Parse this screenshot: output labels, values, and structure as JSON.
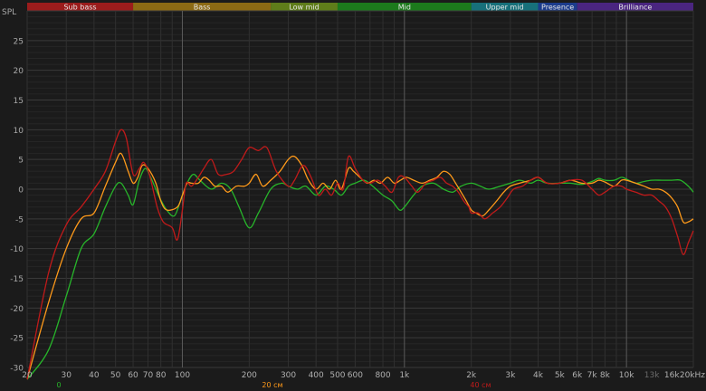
{
  "chart_data": {
    "type": "line",
    "ylabel": "SPL",
    "x_scale": "log",
    "xlim": [
      20,
      20000
    ],
    "ylim": [
      -30,
      30
    ],
    "grid": true,
    "y_ticks": [
      25,
      20,
      15,
      10,
      5,
      0,
      -5,
      -10,
      -15,
      -20,
      -25,
      -30
    ],
    "x_ticks": [
      {
        "value": 20,
        "label": "20"
      },
      {
        "value": 30,
        "label": "30"
      },
      {
        "value": 40,
        "label": "40"
      },
      {
        "value": 50,
        "label": "50"
      },
      {
        "value": 60,
        "label": "60"
      },
      {
        "value": 70,
        "label": "70"
      },
      {
        "value": 80,
        "label": "80"
      },
      {
        "value": 100,
        "label": "100"
      },
      {
        "value": 200,
        "label": "200"
      },
      {
        "value": 300,
        "label": "300"
      },
      {
        "value": 400,
        "label": "400"
      },
      {
        "value": 500,
        "label": "500"
      },
      {
        "value": 600,
        "label": "600"
      },
      {
        "value": 800,
        "label": "800"
      },
      {
        "value": 1000,
        "label": "1k"
      },
      {
        "value": 2000,
        "label": "2k"
      },
      {
        "value": 3000,
        "label": "3k"
      },
      {
        "value": 4000,
        "label": "4k"
      },
      {
        "value": 5000,
        "label": "5k"
      },
      {
        "value": 6000,
        "label": "6k"
      },
      {
        "value": 7000,
        "label": "7k"
      },
      {
        "value": 8000,
        "label": "8k"
      },
      {
        "value": 10000,
        "label": "10k"
      },
      {
        "value": 13000,
        "label": "13k"
      },
      {
        "value": 16000,
        "label": "16k"
      },
      {
        "value": 20000,
        "label": "20kHz"
      }
    ],
    "bands": [
      {
        "name": "Sub bass",
        "from": 20,
        "to": 60,
        "color": "#9b1c1c"
      },
      {
        "name": "Bass",
        "from": 60,
        "to": 250,
        "color": "#8c6a14"
      },
      {
        "name": "Low mid",
        "from": 250,
        "to": 500,
        "color": "#5f7d1a"
      },
      {
        "name": "Mid",
        "from": 500,
        "to": 2000,
        "color": "#1c7a1c"
      },
      {
        "name": "Upper mid",
        "from": 2000,
        "to": 4000,
        "color": "#17707a"
      },
      {
        "name": "Presence",
        "from": 4000,
        "to": 6000,
        "color": "#1c3c8c"
      },
      {
        "name": "Brilliance",
        "from": 6000,
        "to": 20000,
        "color": "#4a2580"
      }
    ],
    "series": [
      {
        "name": "0",
        "color": "#27b52a",
        "points": [
          [
            20,
            -32
          ],
          [
            25,
            -27
          ],
          [
            30,
            -18
          ],
          [
            35,
            -10
          ],
          [
            40,
            -7.5
          ],
          [
            45,
            -3
          ],
          [
            50,
            0.5
          ],
          [
            53,
            1
          ],
          [
            57,
            -1
          ],
          [
            60,
            -2.6
          ],
          [
            64,
            1.5
          ],
          [
            68,
            3.5
          ],
          [
            72,
            2
          ],
          [
            78,
            -1
          ],
          [
            85,
            -3.5
          ],
          [
            92,
            -4.5
          ],
          [
            98,
            -2
          ],
          [
            105,
            1
          ],
          [
            112,
            2.5
          ],
          [
            120,
            1.5
          ],
          [
            135,
            0
          ],
          [
            150,
            1
          ],
          [
            165,
            0
          ],
          [
            180,
            -3
          ],
          [
            200,
            -6.5
          ],
          [
            220,
            -4
          ],
          [
            250,
            0
          ],
          [
            280,
            1
          ],
          [
            300,
            0.5
          ],
          [
            330,
            0
          ],
          [
            360,
            0.5
          ],
          [
            400,
            -1
          ],
          [
            440,
            0.5
          ],
          [
            480,
            0
          ],
          [
            520,
            -1
          ],
          [
            560,
            0.5
          ],
          [
            600,
            1
          ],
          [
            660,
            1.5
          ],
          [
            720,
            0.5
          ],
          [
            800,
            -1
          ],
          [
            880,
            -2
          ],
          [
            950,
            -3.5
          ],
          [
            1000,
            -3
          ],
          [
            1100,
            -1
          ],
          [
            1200,
            0.5
          ],
          [
            1350,
            1
          ],
          [
            1500,
            0
          ],
          [
            1650,
            -0.5
          ],
          [
            1800,
            0.5
          ],
          [
            2000,
            1
          ],
          [
            2200,
            0.5
          ],
          [
            2400,
            0
          ],
          [
            2700,
            0.5
          ],
          [
            3000,
            1
          ],
          [
            3300,
            1.5
          ],
          [
            3700,
            1
          ],
          [
            4000,
            1.5
          ],
          [
            4400,
            1
          ],
          [
            5000,
            1
          ],
          [
            5600,
            1
          ],
          [
            6300,
            0.8
          ],
          [
            7000,
            1.3
          ],
          [
            7500,
            1.8
          ],
          [
            8000,
            1.5
          ],
          [
            8800,
            1.5
          ],
          [
            9500,
            2
          ],
          [
            10000,
            1.7
          ],
          [
            11000,
            1
          ],
          [
            12000,
            1.3
          ],
          [
            13000,
            1.5
          ],
          [
            14500,
            1.5
          ],
          [
            16000,
            1.5
          ],
          [
            17500,
            1.5
          ],
          [
            19000,
            0.5
          ],
          [
            20000,
            -0.5
          ]
        ]
      },
      {
        "name": "20 см",
        "color": "#ff9a1a",
        "points": [
          [
            20,
            -32
          ],
          [
            25,
            -19
          ],
          [
            30,
            -10
          ],
          [
            35,
            -5
          ],
          [
            40,
            -4
          ],
          [
            45,
            0.5
          ],
          [
            50,
            4.5
          ],
          [
            53,
            6
          ],
          [
            57,
            3
          ],
          [
            60,
            1
          ],
          [
            63,
            2
          ],
          [
            66,
            4
          ],
          [
            70,
            3.5
          ],
          [
            76,
            1
          ],
          [
            80,
            -2
          ],
          [
            85,
            -3.5
          ],
          [
            95,
            -3
          ],
          [
            100,
            -1
          ],
          [
            105,
            1
          ],
          [
            110,
            1
          ],
          [
            118,
            1
          ],
          [
            125,
            2
          ],
          [
            132,
            1.5
          ],
          [
            140,
            0.5
          ],
          [
            150,
            0.5
          ],
          [
            160,
            -0.5
          ],
          [
            175,
            0.5
          ],
          [
            190,
            0.5
          ],
          [
            200,
            1
          ],
          [
            215,
            2.5
          ],
          [
            230,
            0.5
          ],
          [
            250,
            1.5
          ],
          [
            275,
            3
          ],
          [
            300,
            5
          ],
          [
            320,
            5.5
          ],
          [
            345,
            4
          ],
          [
            370,
            1.5
          ],
          [
            400,
            0
          ],
          [
            430,
            1
          ],
          [
            460,
            0
          ],
          [
            490,
            1.5
          ],
          [
            520,
            0
          ],
          [
            560,
            3.5
          ],
          [
            590,
            3
          ],
          [
            630,
            2
          ],
          [
            680,
            1
          ],
          [
            730,
            1.5
          ],
          [
            780,
            1
          ],
          [
            840,
            2
          ],
          [
            900,
            1
          ],
          [
            960,
            1.5
          ],
          [
            1020,
            2
          ],
          [
            1100,
            1.5
          ],
          [
            1200,
            1
          ],
          [
            1300,
            1.5
          ],
          [
            1400,
            2
          ],
          [
            1500,
            3
          ],
          [
            1600,
            2.5
          ],
          [
            1700,
            1
          ],
          [
            1800,
            -0.5
          ],
          [
            1900,
            -2
          ],
          [
            2000,
            -3.5
          ],
          [
            2100,
            -4
          ],
          [
            2250,
            -4.5
          ],
          [
            2400,
            -3.5
          ],
          [
            2600,
            -2
          ],
          [
            2800,
            -0.5
          ],
          [
            3000,
            0.5
          ],
          [
            3300,
            1
          ],
          [
            3700,
            1.5
          ],
          [
            4000,
            2
          ],
          [
            4400,
            1
          ],
          [
            5000,
            1
          ],
          [
            5600,
            1.5
          ],
          [
            6300,
            1
          ],
          [
            7000,
            1
          ],
          [
            7500,
            1.5
          ],
          [
            8000,
            1.2
          ],
          [
            8800,
            0.5
          ],
          [
            9500,
            1.5
          ],
          [
            10000,
            1.5
          ],
          [
            11000,
            1
          ],
          [
            12000,
            0.5
          ],
          [
            13000,
            0
          ],
          [
            14000,
            0
          ],
          [
            15000,
            -0.5
          ],
          [
            16000,
            -1.5
          ],
          [
            17000,
            -3
          ],
          [
            18000,
            -5.5
          ],
          [
            19000,
            -5.5
          ],
          [
            20000,
            -5
          ]
        ]
      },
      {
        "name": "40 см",
        "color": "#c01a1a",
        "points": [
          [
            20,
            -32
          ],
          [
            25,
            -14
          ],
          [
            30,
            -6
          ],
          [
            35,
            -3
          ],
          [
            40,
            0
          ],
          [
            45,
            3
          ],
          [
            50,
            8
          ],
          [
            53,
            10
          ],
          [
            56,
            8.5
          ],
          [
            60,
            2.5
          ],
          [
            64,
            3.5
          ],
          [
            67,
            4.5
          ],
          [
            71,
            2.5
          ],
          [
            77,
            -3
          ],
          [
            82,
            -5.5
          ],
          [
            90,
            -6.5
          ],
          [
            95,
            -8.5
          ],
          [
            100,
            -3.5
          ],
          [
            104,
            1
          ],
          [
            110,
            0.5
          ],
          [
            118,
            2
          ],
          [
            125,
            3.5
          ],
          [
            135,
            5
          ],
          [
            145,
            2.5
          ],
          [
            158,
            2.5
          ],
          [
            170,
            3
          ],
          [
            185,
            5
          ],
          [
            200,
            7
          ],
          [
            220,
            6.5
          ],
          [
            240,
            7
          ],
          [
            265,
            3
          ],
          [
            300,
            0.5
          ],
          [
            320,
            1.5
          ],
          [
            350,
            4
          ],
          [
            380,
            2
          ],
          [
            410,
            -1
          ],
          [
            440,
            0
          ],
          [
            470,
            -1
          ],
          [
            500,
            1
          ],
          [
            530,
            0
          ],
          [
            560,
            5.5
          ],
          [
            600,
            3.5
          ],
          [
            650,
            1.5
          ],
          [
            700,
            1
          ],
          [
            760,
            1.5
          ],
          [
            820,
            0.5
          ],
          [
            880,
            -0.5
          ],
          [
            940,
            2
          ],
          [
            1000,
            2
          ],
          [
            1080,
            0.5
          ],
          [
            1150,
            -0.5
          ],
          [
            1250,
            1
          ],
          [
            1350,
            1.5
          ],
          [
            1450,
            2
          ],
          [
            1550,
            1
          ],
          [
            1650,
            0.5
          ],
          [
            1750,
            -0.5
          ],
          [
            1850,
            -2
          ],
          [
            1950,
            -3
          ],
          [
            2000,
            -4
          ],
          [
            2150,
            -4
          ],
          [
            2300,
            -5
          ],
          [
            2500,
            -4
          ],
          [
            2700,
            -3
          ],
          [
            2900,
            -1.5
          ],
          [
            3100,
            0
          ],
          [
            3400,
            0.5
          ],
          [
            3700,
            1.5
          ],
          [
            4000,
            2
          ],
          [
            4400,
            1
          ],
          [
            5000,
            1
          ],
          [
            5600,
            1.5
          ],
          [
            6300,
            1.5
          ],
          [
            7000,
            0
          ],
          [
            7500,
            -1
          ],
          [
            8000,
            -0.5
          ],
          [
            8800,
            0.5
          ],
          [
            9500,
            0.5
          ],
          [
            10000,
            0
          ],
          [
            11000,
            -0.5
          ],
          [
            12000,
            -1
          ],
          [
            13000,
            -1
          ],
          [
            14000,
            -2
          ],
          [
            15000,
            -3
          ],
          [
            16000,
            -5
          ],
          [
            17000,
            -8
          ],
          [
            18000,
            -11
          ],
          [
            19000,
            -9
          ],
          [
            20000,
            -7
          ]
        ]
      }
    ]
  }
}
